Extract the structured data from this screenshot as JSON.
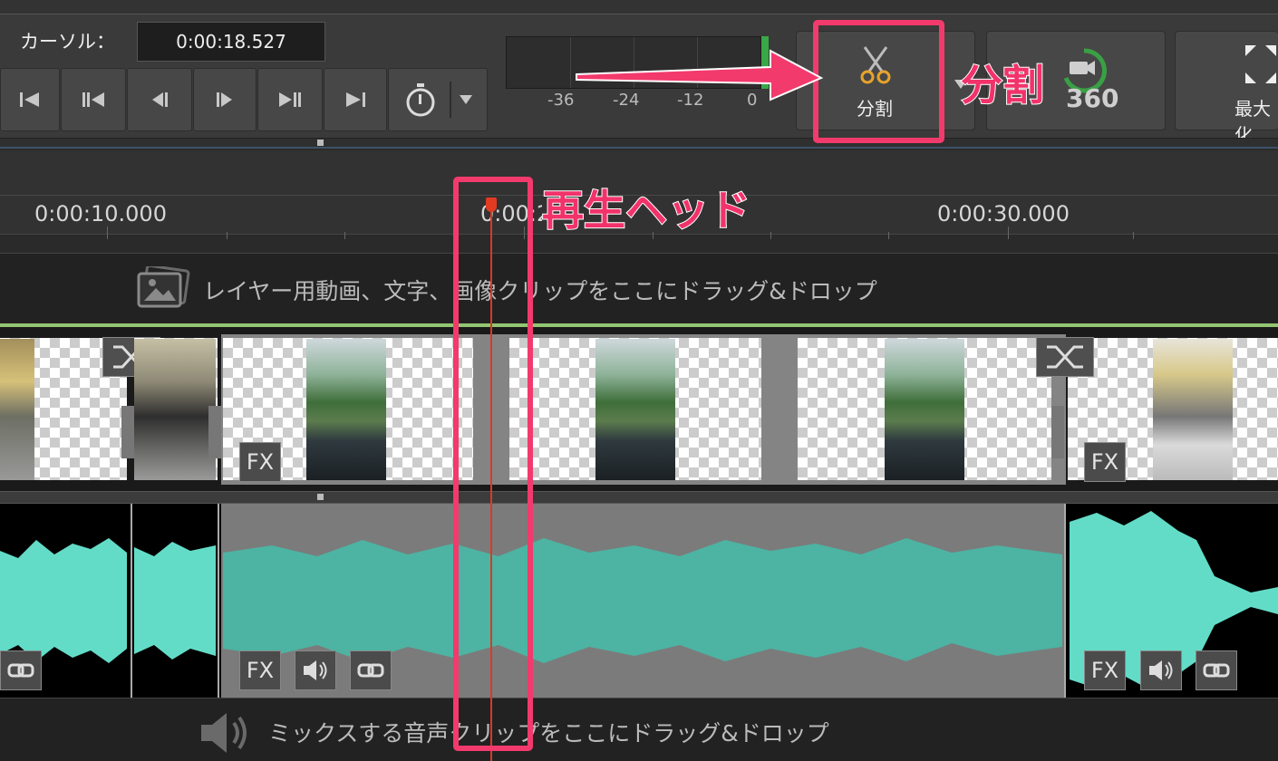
{
  "toolbar": {
    "cursor_label": "カーソル：",
    "cursor_time": "0:00:18.527",
    "meter_labels": [
      "-36",
      "-24",
      "-12",
      "0"
    ],
    "split_label": "分割",
    "maximize_label": "最大化",
    "badge_360": "360"
  },
  "timeline": {
    "ruler_labels": [
      "0:00:10.000",
      "0:00:20.000",
      "0:00:30.000"
    ],
    "layer_drop_text": "レイヤー用動画、文字、画像クリップをここにドラッグ&ドロップ",
    "mix_drop_text": "ミックスする音声クリップをここにドラッグ&ドロップ",
    "fx_label": "FX"
  },
  "annotations": {
    "split": "分割",
    "playhead": "再生ヘッド"
  },
  "colors": {
    "highlight": "#f23a6c",
    "waveform": "#63dcc7",
    "waveform_selected": "#4db3a2",
    "playhead": "#d93b22",
    "track_top": "#93c672"
  }
}
